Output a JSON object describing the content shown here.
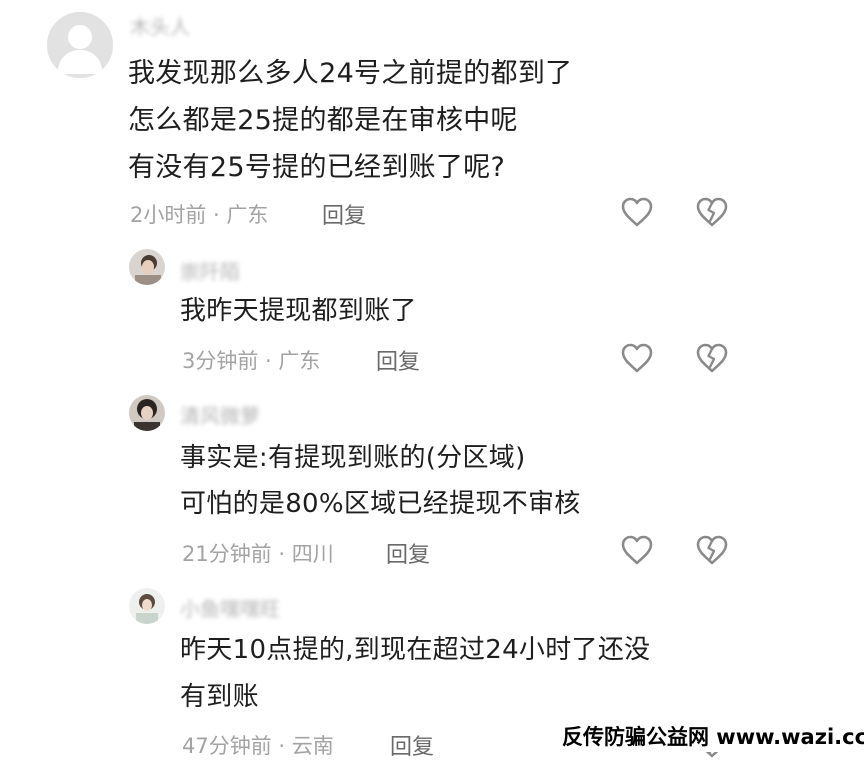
{
  "comments": [
    {
      "username": "木头人",
      "lines": [
        "我发现那么多人24号之前提的都到了",
        "怎么都是25提的都是在审核中呢",
        "有没有25号提的已经到账了呢?"
      ],
      "meta": "2小时前 · 广东",
      "reply_label": "回复",
      "like_icon": "heart-outline-icon",
      "dislike_icon": "broken-heart-icon"
    },
    {
      "username": "崇阡陌",
      "lines": [
        "我昨天提现都到账了"
      ],
      "meta": "3分钟前 · 广东",
      "reply_label": "回复",
      "like_icon": "heart-outline-icon",
      "dislike_icon": "broken-heart-icon"
    },
    {
      "username": "清风微萝",
      "lines": [
        "事实是:有提现到账的(分区域)",
        "可怕的是80%区域已经提现不审核"
      ],
      "meta": "21分钟前 · 四川",
      "reply_label": "回复",
      "like_icon": "heart-outline-icon",
      "dislike_icon": "broken-heart-icon"
    },
    {
      "username": "小鱼嘿嘿旺",
      "lines": [
        "昨天10点提的,到现在超过24小时了还没",
        "有到账"
      ],
      "meta": "47分钟前 · 云南",
      "reply_label": "回复",
      "like_icon": "heart-outline-icon",
      "dislike_icon": "broken-heart-icon"
    }
  ],
  "watermark": "反传防骗公益网 www.wazi.cc",
  "colors": {
    "text": "#1e1e1e",
    "meta": "#a3a3a3",
    "reply": "#6a6a6a",
    "icon": "#8a8a8a"
  }
}
